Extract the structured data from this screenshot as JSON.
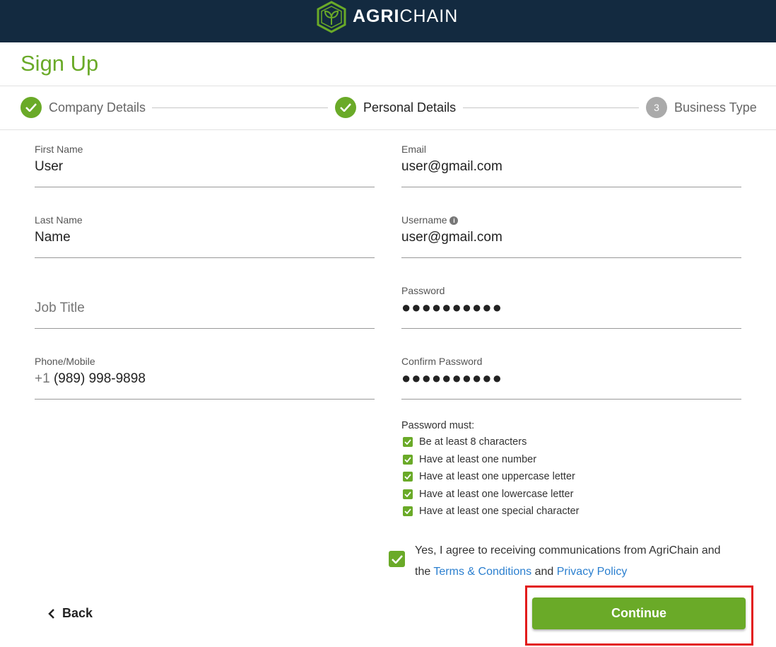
{
  "header": {
    "brand_bold": "AGRI",
    "brand_light": "CHAIN"
  },
  "page": {
    "title": "Sign Up"
  },
  "stepper": [
    {
      "label": "Company Details",
      "state": "done"
    },
    {
      "label": "Personal Details",
      "state": "active"
    },
    {
      "number": "3",
      "label": "Business Type",
      "state": "pending"
    }
  ],
  "form": {
    "first_name": {
      "label": "First Name",
      "value": "User"
    },
    "last_name": {
      "label": "Last Name",
      "value": "Name"
    },
    "job_title": {
      "placeholder": "Job Title"
    },
    "phone": {
      "label": "Phone/Mobile",
      "prefix": "+1",
      "value": "(989) 998-9898"
    },
    "email": {
      "label": "Email",
      "value": "user@gmail.com"
    },
    "username": {
      "label": "Username",
      "value": "user@gmail.com"
    },
    "password": {
      "label": "Password",
      "value": "●●●●●●●●●●"
    },
    "confirm_password": {
      "label": "Confirm Password",
      "value": "●●●●●●●●●●"
    }
  },
  "password_rules": {
    "heading": "Password must:",
    "items": [
      "Be at least 8 characters",
      "Have at least one number",
      "Have at least one uppercase letter",
      "Have at least one lowercase letter",
      "Have at least one special character"
    ]
  },
  "agreement": {
    "line1": "Yes, I agree to receiving communications from AgriChain and",
    "the": "the",
    "terms": "Terms & Conditions",
    "and": "and",
    "privacy": "Privacy Policy"
  },
  "actions": {
    "back": "Back",
    "continue": "Continue"
  },
  "colors": {
    "brand_green": "#6aaa28",
    "header_bg": "#132a40",
    "link": "#2b7fcf"
  }
}
